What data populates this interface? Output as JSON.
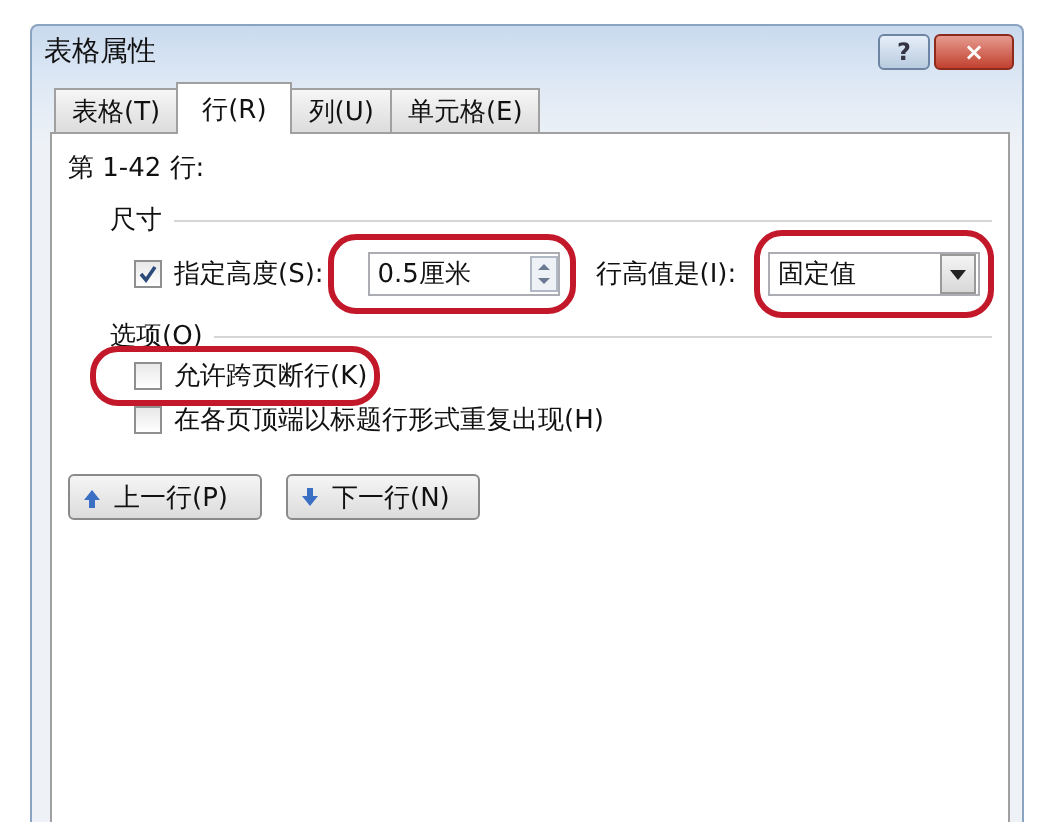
{
  "window": {
    "title": "表格属性",
    "help_button": "?",
    "close_button": "×"
  },
  "tabs": [
    {
      "label": "表格(T)",
      "selected": false
    },
    {
      "label": "行(R)",
      "selected": true
    },
    {
      "label": "列(U)",
      "selected": false
    },
    {
      "label": "单元格(E)",
      "selected": false
    }
  ],
  "row_range": "第 1-42 行:",
  "size_group": {
    "title": "尺寸",
    "specify_height": {
      "label": "指定高度(S):",
      "checked": true
    },
    "height_field": {
      "value": "0.5厘米",
      "highlighted": true
    },
    "row_height_label": "行高值是(I):",
    "row_height_select": {
      "value": "固定值",
      "highlighted": true
    }
  },
  "options_group": {
    "title": "选项(O)",
    "items": [
      {
        "label": "允许跨页断行(K)",
        "checked": false,
        "highlighted": true
      },
      {
        "label": "在各页顶端以标题行形式重复出现(H)",
        "checked": false,
        "highlighted": false
      }
    ]
  },
  "nav_buttons": [
    {
      "label": "上一行(P)",
      "kind": "up"
    },
    {
      "label": "下一行(N)",
      "kind": "down"
    }
  ]
}
